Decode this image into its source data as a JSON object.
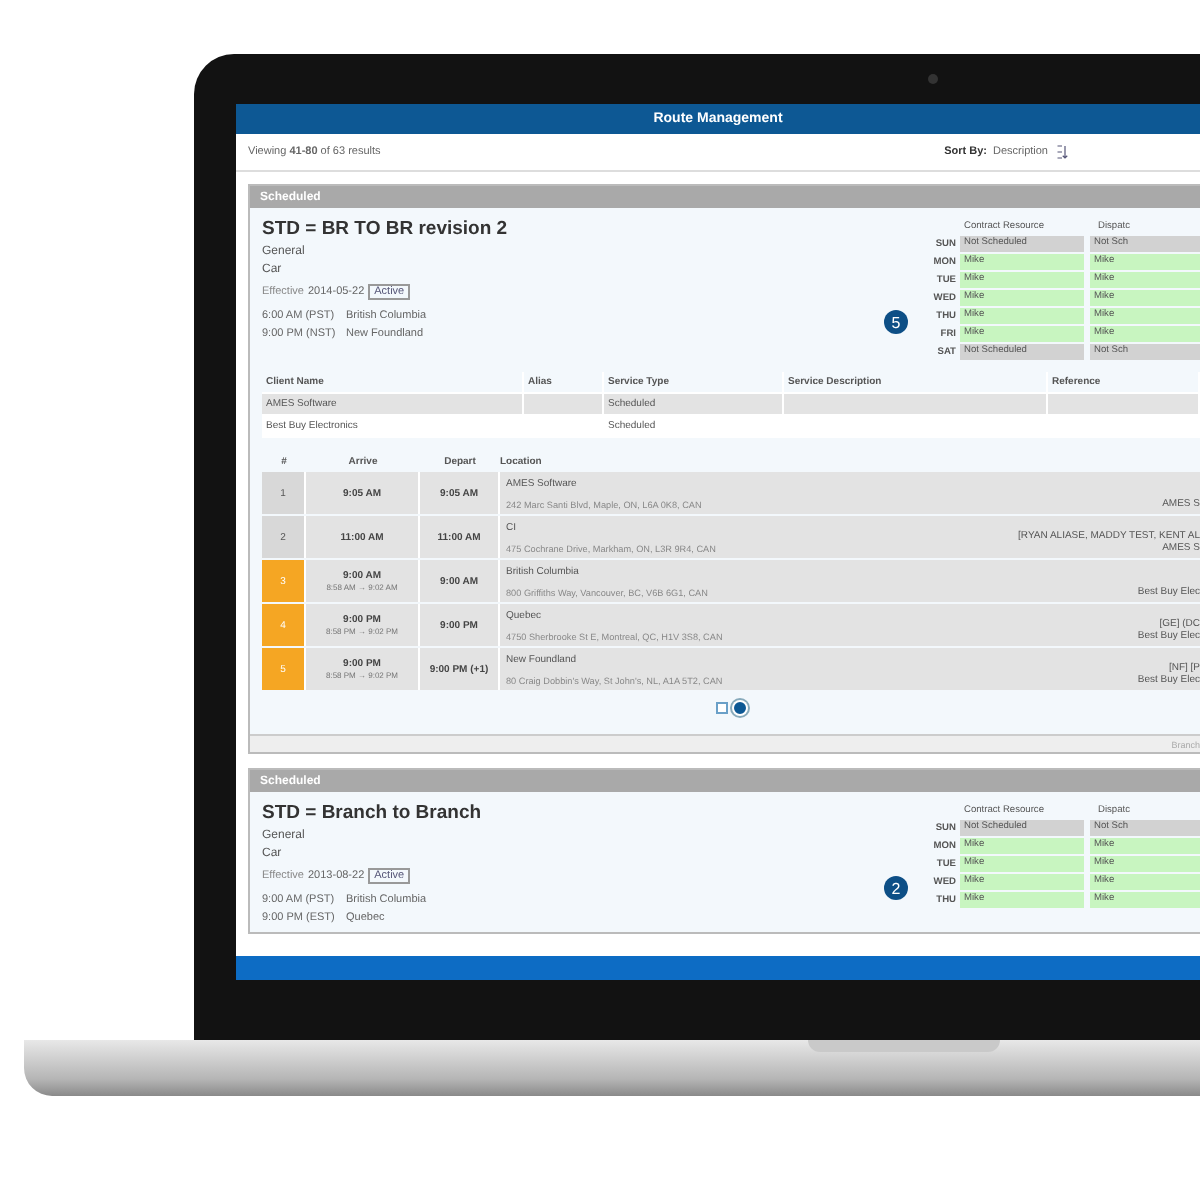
{
  "window": {
    "title": "Route Management"
  },
  "results": {
    "summary": "Viewing **41-80** of 63 results",
    "sort_label": "Sort By:",
    "sort_value": "Description"
  },
  "routes": [
    {
      "header": "Scheduled",
      "title": "STD = BR TO BR revision 2",
      "lines": [
        "General",
        "Car"
      ],
      "effective_label": "Effective",
      "effective_date": "2014-05-22",
      "status": "Active",
      "summary": [
        {
          "time": "6:00 AM (PST)",
          "place": "British Columbia"
        },
        {
          "time": "9:00 PM (NST)",
          "place": "New Foundland"
        }
      ],
      "stop_count": "5",
      "schedule": {
        "columns": [
          "Contract Resource",
          "Dispatc"
        ],
        "days": [
          {
            "day": "SUN",
            "scheduled": false,
            "values": [
              "Not Scheduled",
              "Not Sch"
            ]
          },
          {
            "day": "MON",
            "scheduled": true,
            "values": [
              "Mike",
              "Mike"
            ]
          },
          {
            "day": "TUE",
            "scheduled": true,
            "values": [
              "Mike",
              "Mike"
            ]
          },
          {
            "day": "WED",
            "scheduled": true,
            "values": [
              "Mike",
              "Mike"
            ]
          },
          {
            "day": "THU",
            "scheduled": true,
            "values": [
              "Mike",
              "Mike"
            ]
          },
          {
            "day": "FRI",
            "scheduled": true,
            "values": [
              "Mike",
              "Mike"
            ]
          },
          {
            "day": "SAT",
            "scheduled": false,
            "values": [
              "Not Scheduled",
              "Not Sch"
            ]
          }
        ]
      },
      "clients": {
        "columns": [
          "Client Name",
          "Alias",
          "Service Type",
          "Service Description",
          "Reference"
        ],
        "rows": [
          [
            "AMES Software",
            "",
            "Scheduled",
            "",
            ""
          ],
          [
            "Best Buy Electronics",
            "",
            "Scheduled",
            "",
            ""
          ]
        ]
      },
      "stops": {
        "columns": [
          "#",
          "Arrive",
          "Depart",
          "Location"
        ],
        "rows": [
          {
            "number": "1",
            "flagged": false,
            "arrive": "9:05 AM",
            "window": "",
            "depart": "9:05 AM",
            "name": "AMES Software",
            "address": "242 Marc Santi Blvd, Maple, ON, L6A 0K8, CAN",
            "right": [
              "AMES S"
            ]
          },
          {
            "number": "2",
            "flagged": false,
            "arrive": "11:00 AM",
            "window": "",
            "depart": "11:00 AM",
            "name": "CI",
            "address": "475 Cochrane Drive, Markham, ON, L3R 9R4, CAN",
            "right": [
              "[RYAN ALIASE, MADDY TEST, KENT AL",
              "AMES S"
            ]
          },
          {
            "number": "3",
            "flagged": true,
            "arrive": "9:00 AM",
            "window": "8:58 AM → 9:02 AM",
            "depart": "9:00 AM",
            "name": "British Columbia",
            "address": "800 Griffiths Way, Vancouver, BC, V6B 6G1, CAN",
            "right": [
              "Best Buy Elec"
            ]
          },
          {
            "number": "4",
            "flagged": true,
            "arrive": "9:00 PM",
            "window": "8:58 PM → 9:02 PM",
            "depart": "9:00 PM",
            "name": "Quebec",
            "address": "4750 Sherbrooke St E, Montreal, QC, H1V 3S8, CAN",
            "right": [
              "[GE] (DC",
              "Best Buy Elec"
            ]
          },
          {
            "number": "5",
            "flagged": true,
            "arrive": "9:00 PM",
            "window": "8:58 PM → 9:02 PM",
            "depart": "9:00 PM (+1)",
            "name": "New Foundland",
            "address": "80 Craig Dobbin's Way, St John's, NL, A1A 5T2, CAN",
            "right": [
              "[NF] [P",
              "Best Buy Elec"
            ]
          }
        ]
      },
      "pages": [
        {
          "selected": false
        },
        {
          "selected": true
        }
      ],
      "footer": "Branch"
    },
    {
      "header": "Scheduled",
      "title": "STD = Branch to Branch",
      "lines": [
        "General",
        "Car"
      ],
      "effective_label": "Effective",
      "effective_date": "2013-08-22",
      "status": "Active",
      "summary": [
        {
          "time": "9:00 AM (PST)",
          "place": "British Columbia"
        },
        {
          "time": "9:00 PM (EST)",
          "place": "Quebec"
        }
      ],
      "stop_count": "2",
      "schedule": {
        "columns": [
          "Contract Resource",
          "Dispatc"
        ],
        "days": [
          {
            "day": "SUN",
            "scheduled": false,
            "values": [
              "Not Scheduled",
              "Not Sch"
            ]
          },
          {
            "day": "MON",
            "scheduled": true,
            "values": [
              "Mike",
              "Mike"
            ]
          },
          {
            "day": "TUE",
            "scheduled": true,
            "values": [
              "Mike",
              "Mike"
            ]
          },
          {
            "day": "WED",
            "scheduled": true,
            "values": [
              "Mike",
              "Mike"
            ]
          },
          {
            "day": "THU",
            "scheduled": true,
            "values": [
              "Mike",
              "Mike"
            ]
          }
        ]
      }
    }
  ]
}
